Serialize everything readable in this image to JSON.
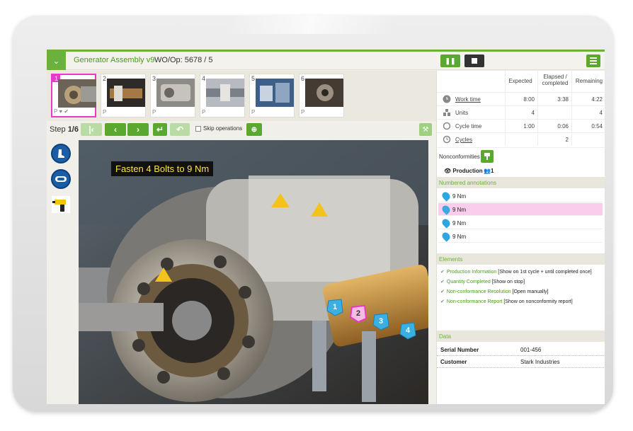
{
  "header": {
    "app_title": "Generator Assembly v9",
    "wo_op": "WO/Op: 5678 / 5",
    "accent_color": "#6ab23d"
  },
  "thumbnails": [
    {
      "num": "1",
      "footer": "P ♥ ✔",
      "active": true
    },
    {
      "num": "2",
      "footer": "P"
    },
    {
      "num": "3",
      "footer": "P"
    },
    {
      "num": "4",
      "footer": "P"
    },
    {
      "num": "5",
      "footer": "P"
    },
    {
      "num": "6",
      "footer": "P"
    }
  ],
  "step_bar": {
    "step_prefix": "Step ",
    "step_value": "1/6",
    "skip_label": "Skip operations"
  },
  "instruction": "Fasten 4 Bolts to 9 Nm",
  "markers": [
    "1",
    "2",
    "3",
    "4"
  ],
  "time_table": {
    "headers": [
      "Expected",
      "Elapsed / completed",
      "Remaining"
    ],
    "rows": [
      {
        "label": "Work time",
        "icon": "clock-icon",
        "expected": "8:00",
        "elapsed": "3:38",
        "remaining": "4:22"
      },
      {
        "label": "Units",
        "icon": "units-icon",
        "expected": "4",
        "elapsed": "",
        "remaining": "4"
      },
      {
        "label": "Cycle time",
        "icon": "cycle-icon",
        "expected": "1:00",
        "elapsed": "0:06",
        "remaining": "0:54"
      },
      {
        "label": "Cycles",
        "icon": "cycles-icon",
        "expected": "",
        "elapsed": "2",
        "remaining": ""
      }
    ]
  },
  "nonconformities_label": "Nonconformities",
  "production": {
    "label": "Production",
    "users": "1"
  },
  "sections": {
    "annotations": "Numbered annotations",
    "elements": "Elements",
    "data": "Data"
  },
  "annotations": [
    {
      "text": "9 Nm",
      "selected": false
    },
    {
      "text": "9 Nm",
      "selected": true
    },
    {
      "text": "9 Nm",
      "selected": false
    },
    {
      "text": "9 Nm",
      "selected": false
    }
  ],
  "elements": [
    {
      "link": "Production Information",
      "note": "[Show on 1st cycle + until completed once]"
    },
    {
      "link": "Quantity Completed",
      "note": "[Show on stop]"
    },
    {
      "link": "Non-conformance Resolution",
      "note": "[Open manually]"
    },
    {
      "link": "Non-conformance Report",
      "note": "[Show on nonconformity report]"
    }
  ],
  "data_rows": [
    {
      "key": "Serial Number",
      "value": "001-456"
    },
    {
      "key": "Customer",
      "value": "Stark Industries"
    }
  ]
}
